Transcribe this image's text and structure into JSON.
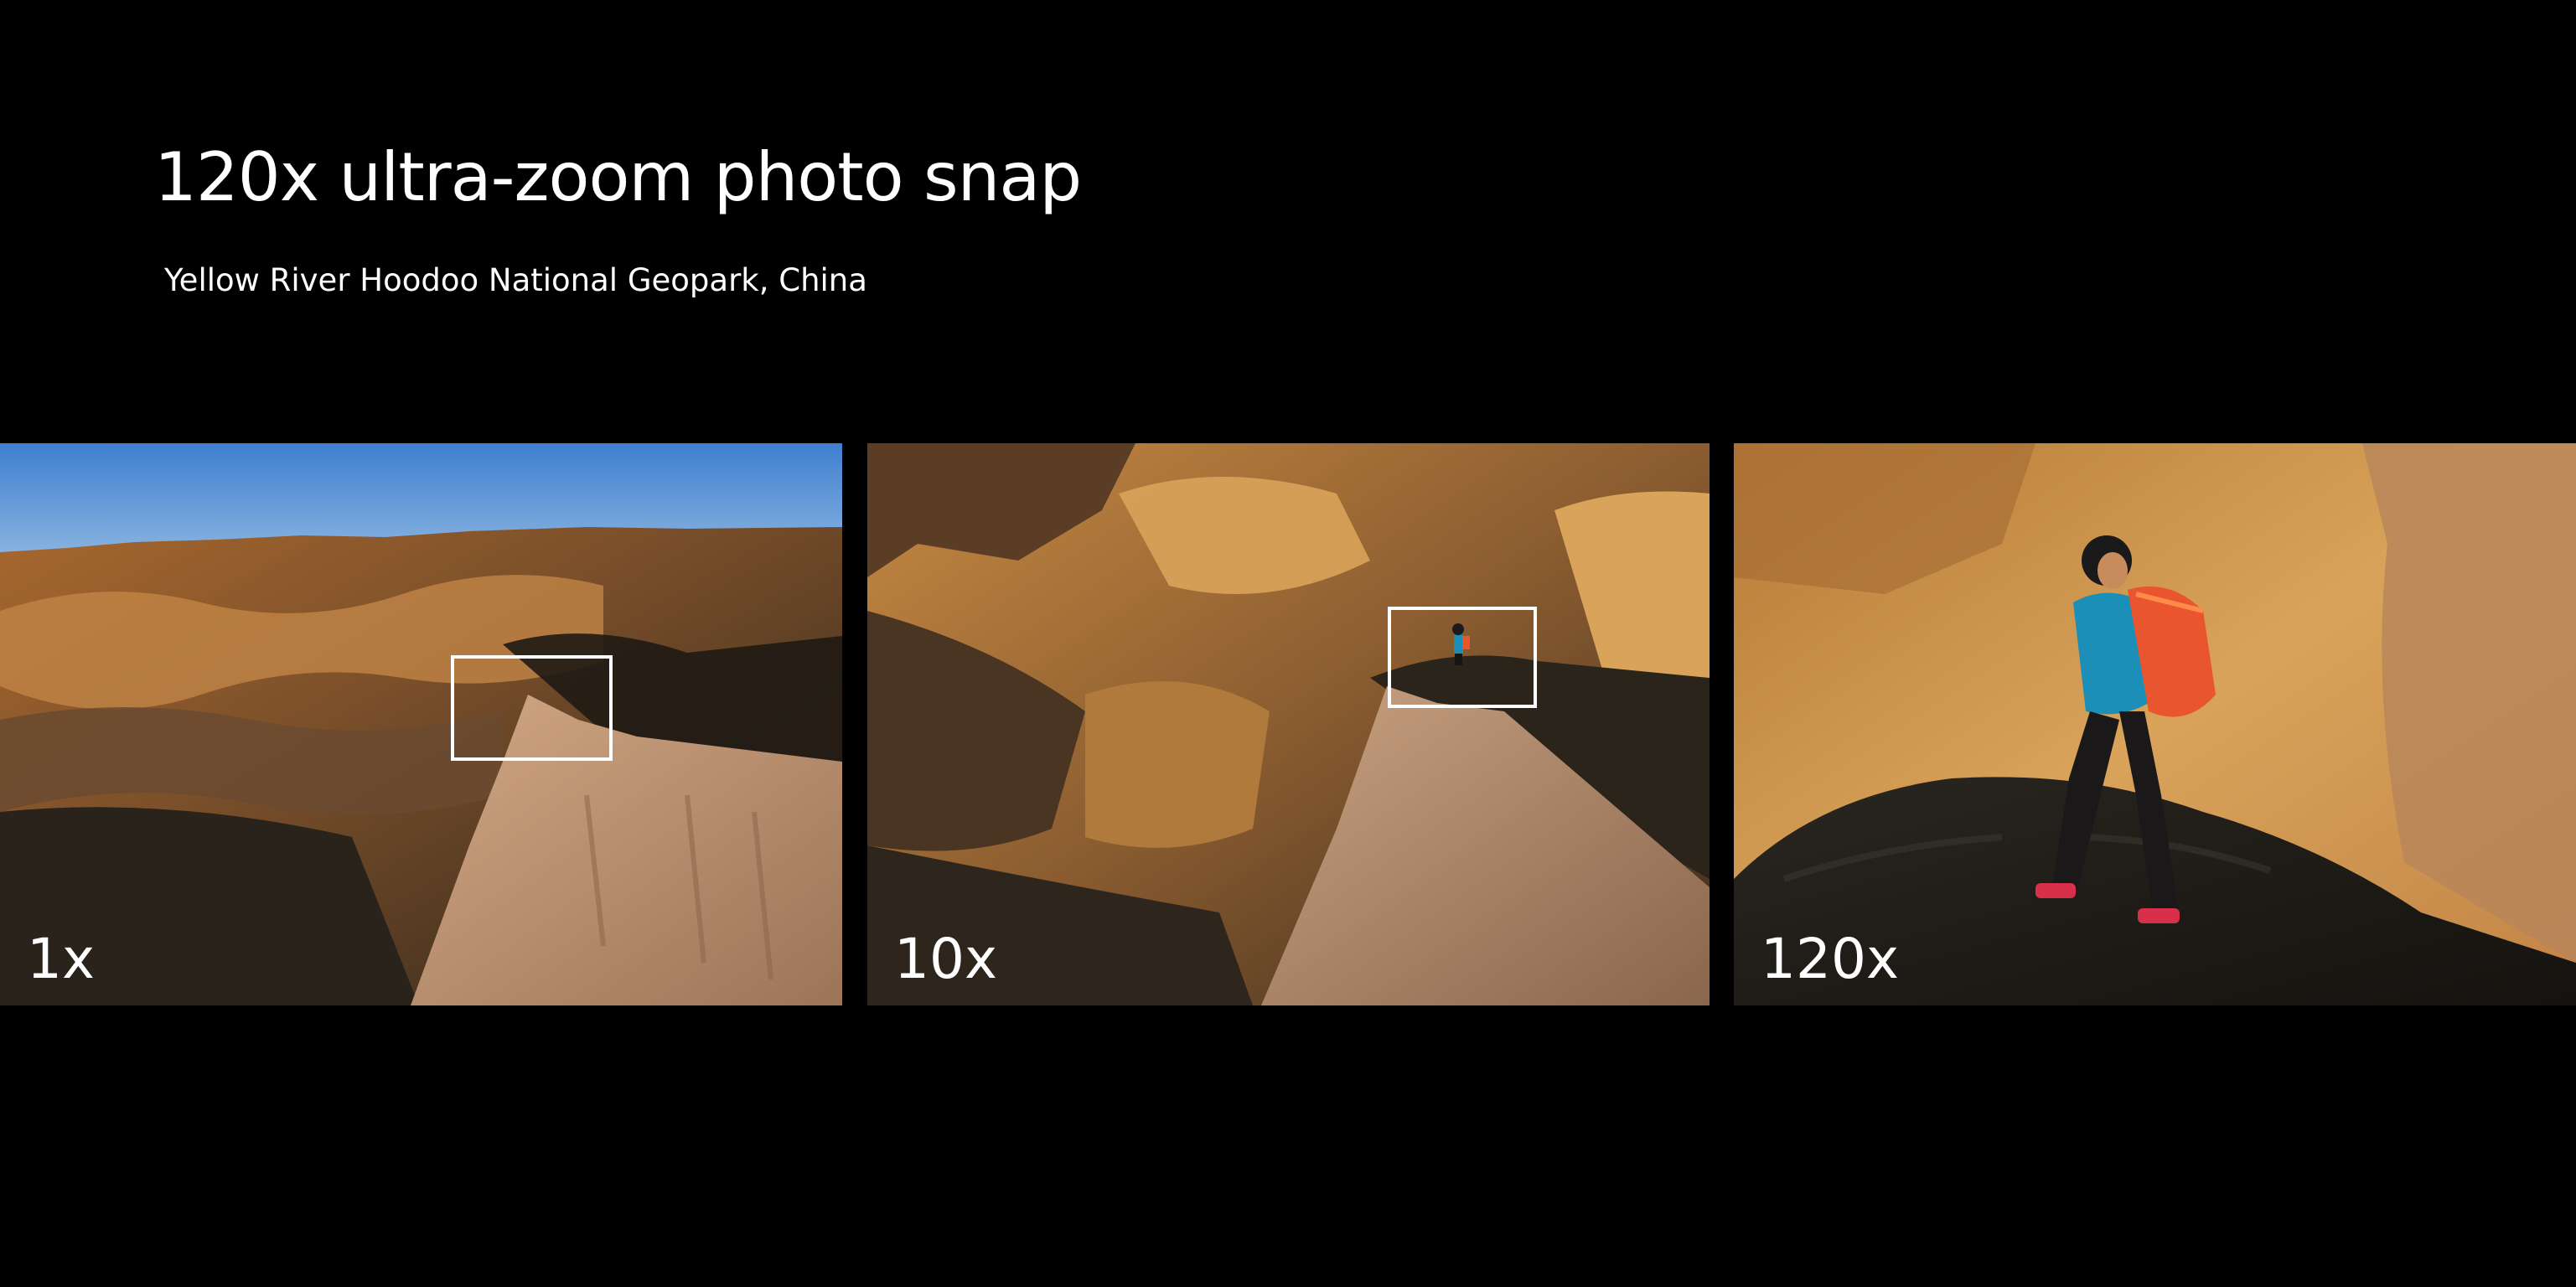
{
  "header": {
    "title": "120x ultra-zoom photo snap",
    "subtitle": "Yellow River Hoodoo National Geopark, China"
  },
  "panels": [
    {
      "label": "1x"
    },
    {
      "label": "10x"
    },
    {
      "label": "120x"
    }
  ],
  "colors": {
    "background": "#000000",
    "text": "#ffffff",
    "sky": "#4a8fd6",
    "rock_light": "#d9a35a",
    "rock_shadow": "#2e261c",
    "jacket": "#1b8fb8",
    "backpack": "#e8552e"
  }
}
